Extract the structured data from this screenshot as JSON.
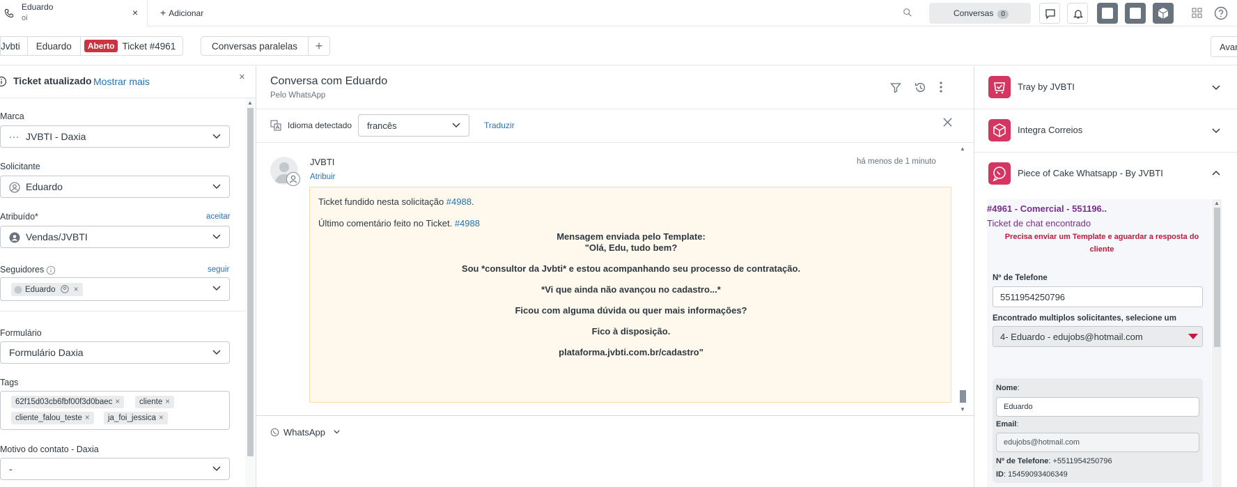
{
  "top_tab": {
    "title": "Eduardo",
    "subtitle": "oi",
    "close": "×"
  },
  "add_tab": {
    "label": "Adicionar",
    "plus": "+"
  },
  "conversations": {
    "label": "Conversas",
    "count": "0"
  },
  "breadcrumb": {
    "org": "Jvbti",
    "user": "Eduardo",
    "status": "Aberto",
    "ticket": "Ticket #4961"
  },
  "parallel": {
    "label": "Conversas paralelas",
    "plus": "+"
  },
  "avan_label": "Avan",
  "left": {
    "title": "Ticket atualizado",
    "show_more": "Mostrar mais",
    "close": "×",
    "brand": {
      "label": "Marca",
      "value": "JVBTI - Daxia"
    },
    "requester": {
      "label": "Solicitante",
      "value": "Eduardo"
    },
    "assignee": {
      "label": "Atribuído*",
      "action": "aceitar",
      "value": "Vendas/JVBTI"
    },
    "followers": {
      "label": "Seguidores",
      "action": "seguir",
      "pill": "Eduardo"
    },
    "form": {
      "label": "Formulário",
      "value": "Formulário Daxia"
    },
    "tags": {
      "label": "Tags",
      "items": [
        "62f15d03cb6fbf00f3d0baec",
        "cliente",
        "cliente_falou_teste",
        "ja_foi_jessica"
      ]
    },
    "reason": {
      "label": "Motivo do contato - Daxia",
      "value": "-"
    }
  },
  "center": {
    "title": "Conversa com Eduardo",
    "subtitle": "Pelo WhatsApp",
    "detected_label": "Idioma detectado",
    "language": "francês",
    "translate": "Traduzir",
    "author": "JVBTI",
    "assign": "Atribuir",
    "time": "há menos de 1 minuto",
    "msg_line1_prefix": "Ticket fundido nesta solicitação ",
    "msg_line1_link": "#4988",
    "msg_line1_suffix": ".",
    "msg_line2_prefix": "Último comentário feito no Ticket. ",
    "msg_line2_link": "#4988",
    "body": [
      "Mensagem enviada pelo Template:",
      "\"Olá, Edu, tudo bem?",
      "Sou *consultor da Jvbti* e estou acompanhando seu processo de contratação.",
      "*Vi que ainda não avançou no cadastro...*",
      "Ficou com alguma dúvida ou quer mais informações?",
      "Fico à disposição.",
      "plataforma.jvbti.com.br/cadastro\""
    ],
    "channel": "WhatsApp"
  },
  "right": {
    "apps": [
      "Tray by JVBTI",
      "Integra Correios",
      "Piece of Cake Whatsapp - By JVBTI"
    ],
    "poc": {
      "ticket_title": "#4961 - Comercial - 551196..",
      "found": "Ticket de chat encontrado",
      "warning": "Precisa enviar um Template e aguardar a resposta do cliente",
      "phone_label": "Nº de Telefone",
      "phone_value": "5511954250796",
      "multi_label": "Encontrado multiplos solicitantes, selecione um",
      "multi_value": "4- Eduardo - edujobs@hotmail.com",
      "name_label": "Nome",
      "name_value": "Eduardo",
      "email_label": "Email",
      "email_value": "edujobs@hotmail.com",
      "tel_label": "Nº de Telefone",
      "tel_value": "+5511954250796",
      "id_label": "ID",
      "id_value": "15459093406349"
    }
  },
  "colors": {
    "accent": "#1f73b7",
    "status_open": "#cc3340",
    "poc_purple": "#7a2d8b",
    "warn_red": "#c4183c",
    "bubble_bg": "#fff8ed"
  }
}
